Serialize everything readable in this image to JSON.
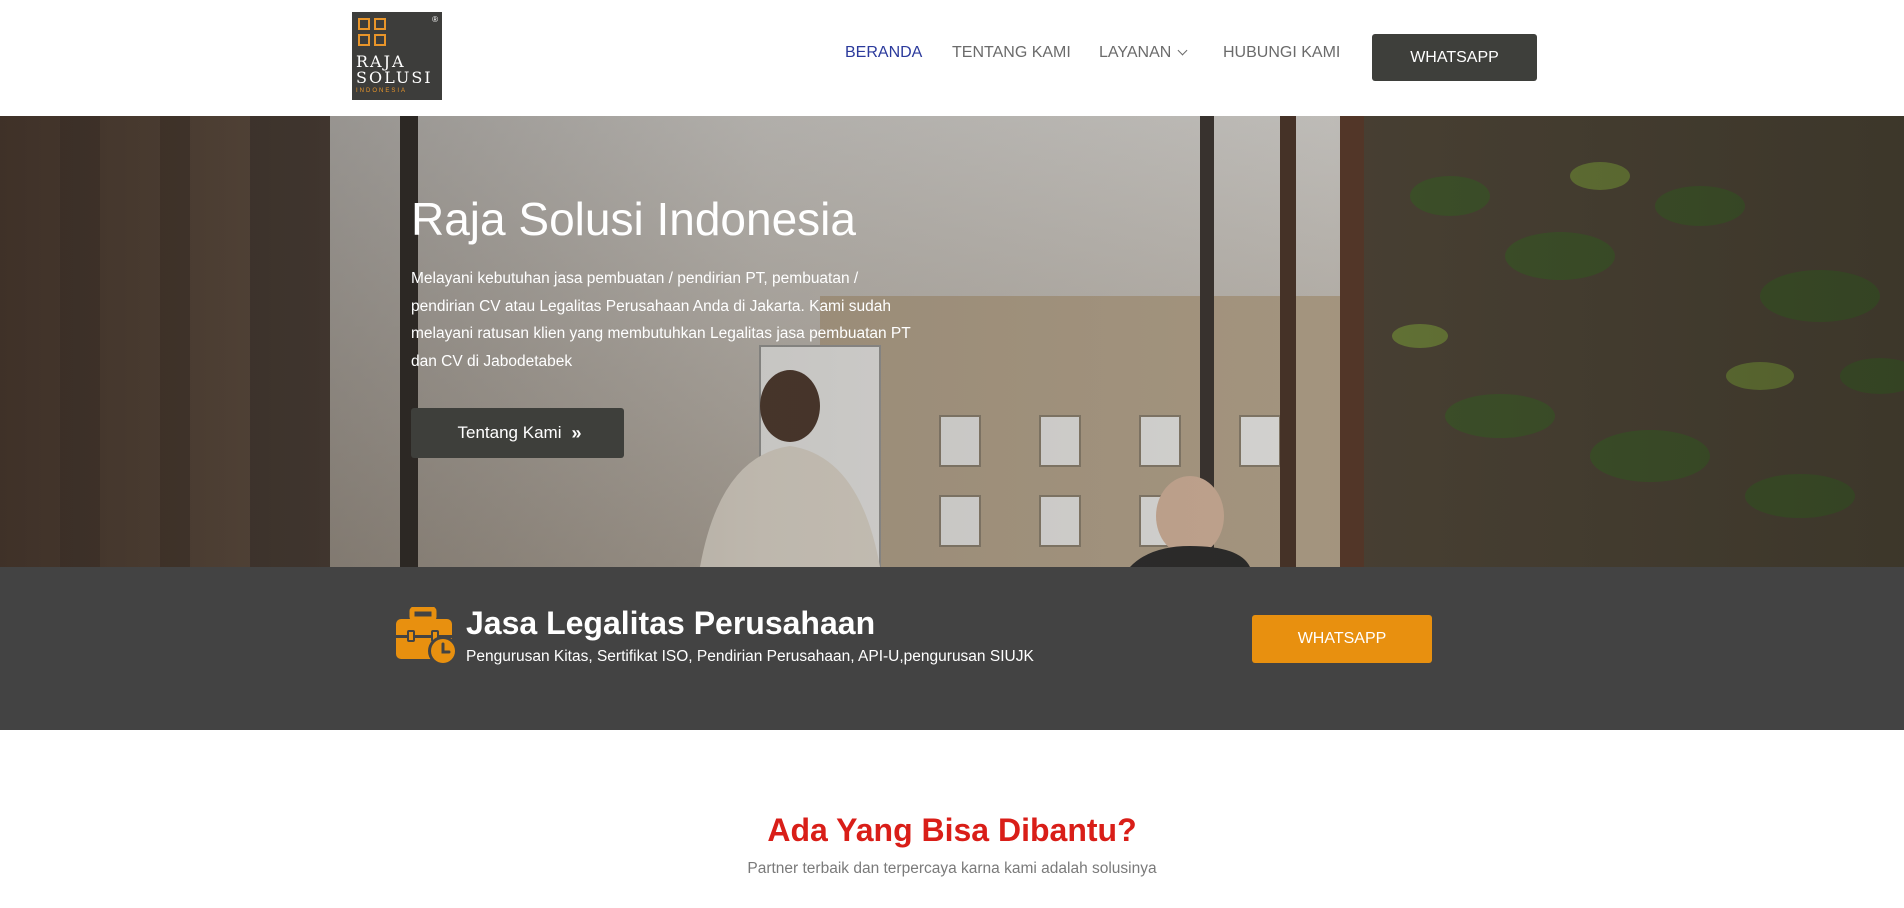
{
  "logo": {
    "line1": "RAJA",
    "line2": "SOLUSI",
    "line3": "INDONESIA",
    "mark": "®",
    "bg_color": "#3d3d3b",
    "accent_color": "#e8952a"
  },
  "nav": {
    "items": [
      {
        "label": "BERANDA",
        "active": true
      },
      {
        "label": "TENTANG KAMI",
        "active": false
      },
      {
        "label": "LAYANAN",
        "active": false,
        "icon": "chevron-down-icon"
      },
      {
        "label": "HUBUNGI KAMI",
        "active": false
      }
    ],
    "cta_label": "WHATSAPP",
    "active_color": "#2b3a9c"
  },
  "hero": {
    "title": "Raja Solusi Indonesia",
    "description": "Melayani kebutuhan jasa pembuatan / pendirian PT, pembuatan / pendirian CV atau Legalitas Perusahaan Anda di Jakarta. Kami sudah melayani ratusan klien yang membutuhkan Legalitas jasa pembuatan PT dan CV di Jabodetabek",
    "button_label": "Tentang Kami",
    "button_icon": "double-chevron-right-icon"
  },
  "band": {
    "icon": "briefcase-clock-icon",
    "title": "Jasa Legalitas Perusahaan",
    "subtitle": "Pengurusan Kitas, Sertifikat ISO, Pendirian Perusahaan, API-U,pengurusan SIUJK",
    "button_label": "WHATSAPP",
    "bg_color": "#434343",
    "button_color": "#e8900f"
  },
  "section": {
    "title": "Ada Yang Bisa Dibantu?",
    "subtitle": "Partner terbaik dan terpercaya karna kami adalah solusinya",
    "title_color": "#d91e18"
  }
}
